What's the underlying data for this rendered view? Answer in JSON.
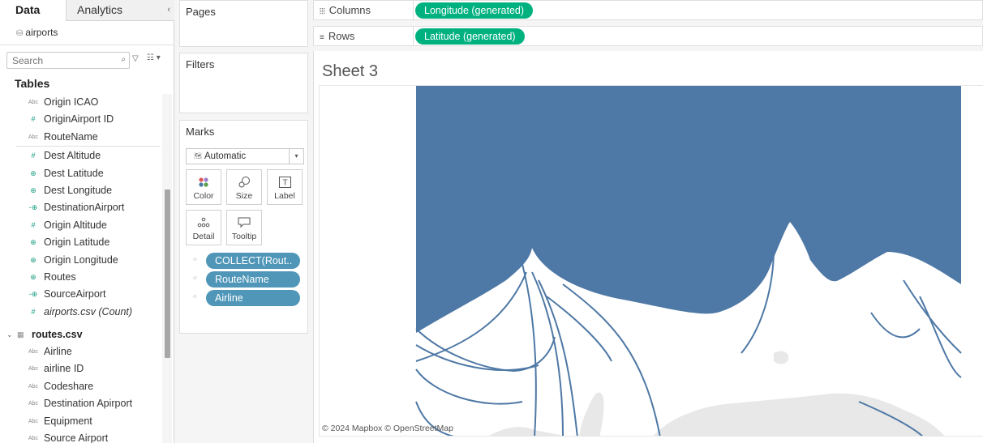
{
  "data_pane": {
    "tab_data": "Data",
    "tab_analytics": "Analytics",
    "datasource_name": "airports",
    "search_placeholder": "Search",
    "tables_heading": "Tables",
    "airports_fields": [
      {
        "label": "Origin ICAO",
        "type": "dim"
      },
      {
        "label": "OriginAirport ID",
        "type": "meas"
      },
      {
        "label": "RouteName",
        "type": "dim"
      },
      {
        "label": "Dest Altitude",
        "type": "meas"
      },
      {
        "label": "Dest Latitude",
        "type": "geo"
      },
      {
        "label": "Dest Longitude",
        "type": "geo"
      },
      {
        "label": "DestinationAirport",
        "type": "geo2"
      },
      {
        "label": "Origin Altitude",
        "type": "meas"
      },
      {
        "label": "Origin Latitude",
        "type": "geo"
      },
      {
        "label": "Origin Longitude",
        "type": "geo"
      },
      {
        "label": "Routes",
        "type": "geo"
      },
      {
        "label": "SourceAirport",
        "type": "geo2"
      },
      {
        "label": "airports.csv (Count)",
        "type": "meas",
        "italic": true
      }
    ],
    "routes_table": "routes.csv",
    "routes_fields": [
      {
        "label": "Airline",
        "type": "dim"
      },
      {
        "label": "airline ID",
        "type": "dim"
      },
      {
        "label": "Codeshare",
        "type": "dim"
      },
      {
        "label": "Destination Apirport",
        "type": "dim"
      },
      {
        "label": "Equipment",
        "type": "dim"
      },
      {
        "label": "Source Airport",
        "type": "dim"
      }
    ]
  },
  "pages": {
    "title": "Pages"
  },
  "filters": {
    "title": "Filters"
  },
  "marks": {
    "title": "Marks",
    "mark_type": "Automatic",
    "buttons": {
      "color": "Color",
      "size": "Size",
      "label": "Label",
      "detail": "Detail",
      "tooltip": "Tooltip"
    },
    "pills": [
      "COLLECT(Rout..",
      "RouteName",
      "Airline"
    ]
  },
  "shelves": {
    "columns_label": "Columns",
    "columns_pill": "Longitude (generated)",
    "rows_label": "Rows",
    "rows_pill": "Latitude (generated)"
  },
  "sheet": {
    "title": "Sheet 3",
    "attribution": "© 2024 Mapbox © OpenStreetMap"
  },
  "colors": {
    "route_line": "#4e78a5",
    "pill_green": "#00b180",
    "pill_blue": "#4f96b8",
    "land": "#e8e8e8"
  }
}
